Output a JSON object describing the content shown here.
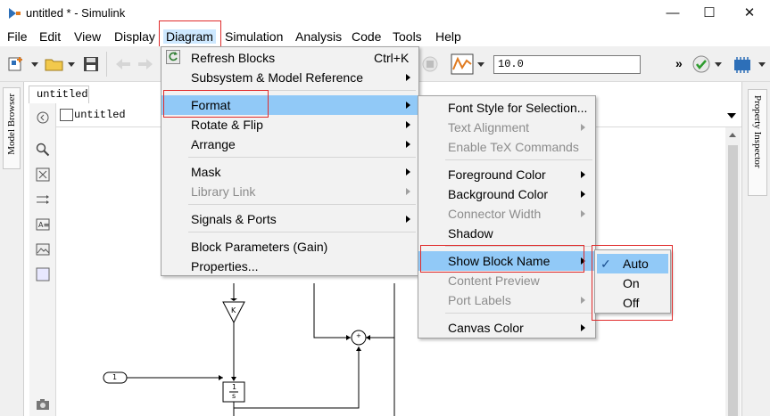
{
  "window": {
    "title": "untitled * - Simulink",
    "minimize_glyph": "—",
    "maximize_glyph": "☐",
    "close_glyph": "✕"
  },
  "menubar": {
    "items": [
      {
        "label": "File"
      },
      {
        "label": "Edit"
      },
      {
        "label": "View"
      },
      {
        "label": "Display"
      },
      {
        "label": "Diagram"
      },
      {
        "label": "Simulation"
      },
      {
        "label": "Analysis"
      },
      {
        "label": "Code"
      },
      {
        "label": "Tools"
      },
      {
        "label": "Help"
      }
    ],
    "active": "Diagram"
  },
  "toolbar": {
    "stop_time": "10.0",
    "overflow": "»"
  },
  "left_panel": {
    "model_browser_label": "Model Browser",
    "tab_label": "untitled",
    "breadcrumb": "untitled"
  },
  "right_panel": {
    "property_inspector_label": "Property Inspector"
  },
  "diagram_menu": {
    "items": [
      {
        "label": "Refresh Blocks",
        "shortcut": "Ctrl+K",
        "icon": "refresh-icon"
      },
      {
        "label": "Subsystem & Model Reference",
        "submenu": true
      },
      {
        "label": "Format",
        "submenu": true,
        "highlighted": true
      },
      {
        "label": "Rotate & Flip",
        "submenu": true
      },
      {
        "label": "Arrange",
        "submenu": true
      },
      {
        "label": "Mask",
        "submenu": true
      },
      {
        "label": "Library Link",
        "submenu": true,
        "disabled": true
      },
      {
        "label": "Signals & Ports",
        "submenu": true
      },
      {
        "label": "Block Parameters (Gain)"
      },
      {
        "label": "Properties..."
      }
    ]
  },
  "format_menu": {
    "items": [
      {
        "label": "Font Style for Selection..."
      },
      {
        "label": "Text Alignment",
        "submenu": true,
        "disabled": true
      },
      {
        "label": "Enable TeX Commands",
        "disabled": true
      },
      {
        "label": "Foreground Color",
        "submenu": true
      },
      {
        "label": "Background Color",
        "submenu": true
      },
      {
        "label": "Connector Width",
        "submenu": true,
        "disabled": true
      },
      {
        "label": "Shadow"
      },
      {
        "label": "Show Block Name",
        "submenu": true,
        "highlighted": true
      },
      {
        "label": "Content Preview",
        "disabled": true
      },
      {
        "label": "Port Labels",
        "submenu": true,
        "disabled": true
      },
      {
        "label": "Canvas Color",
        "submenu": true
      }
    ]
  },
  "block_name_menu": {
    "items": [
      {
        "label": "Auto",
        "checked": true,
        "highlighted": true
      },
      {
        "label": "On"
      },
      {
        "label": "Off"
      }
    ]
  },
  "canvas": {
    "gain_label": "K",
    "inport_label": "1",
    "integrator_top": "1",
    "integrator_bottom": "s"
  },
  "colors": {
    "menu_highlight": "#91c9f7",
    "menubar_active": "#cde8ff",
    "annotation_red": "#e02b2b",
    "disabled_text": "#8c8c8c"
  }
}
